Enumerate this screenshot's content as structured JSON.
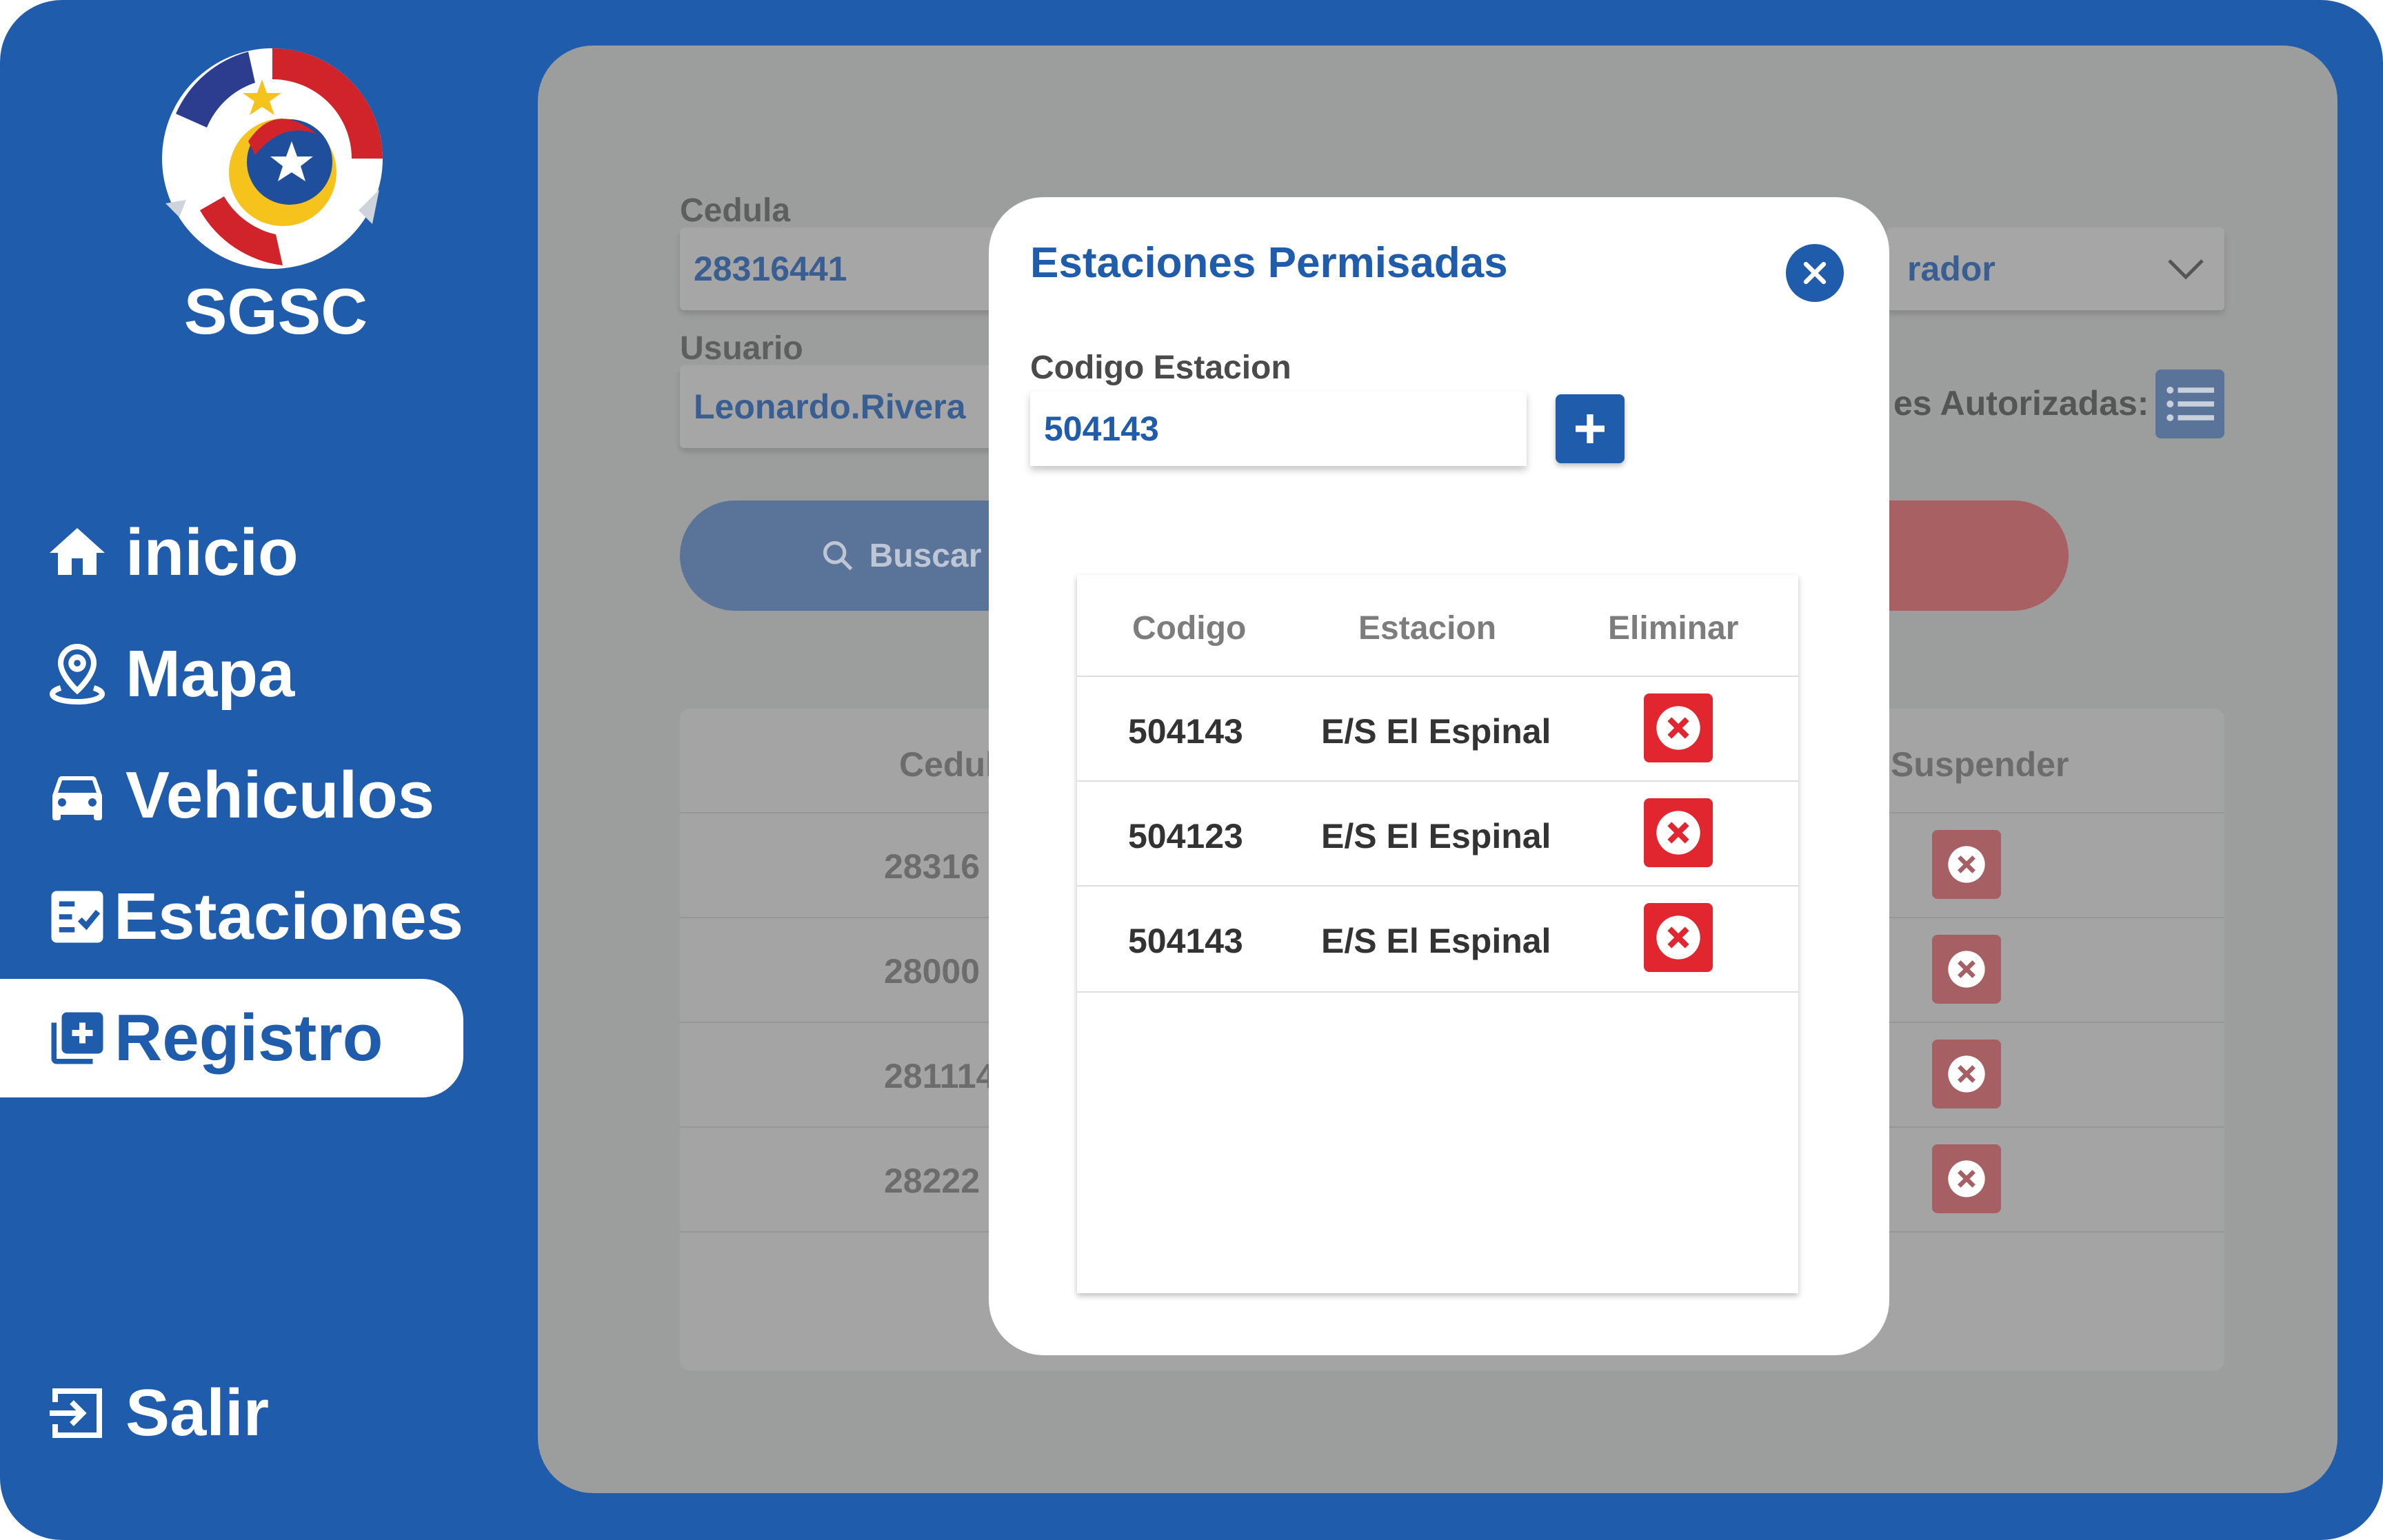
{
  "app": {
    "brand": "SGSC"
  },
  "sidebar": {
    "items": [
      {
        "label": "inicio",
        "icon": "home-icon"
      },
      {
        "label": "Mapa",
        "icon": "map-pin-icon"
      },
      {
        "label": "Vehiculos",
        "icon": "car-icon"
      },
      {
        "label": "Estaciones",
        "icon": "checklist-icon"
      },
      {
        "label": "Registro",
        "icon": "add-box-icon",
        "active": true
      }
    ],
    "logout": {
      "label": "Salir",
      "icon": "logout-icon"
    }
  },
  "form": {
    "cedula_label": "Cedula",
    "cedula_value": "28316441",
    "usuario_label": "Usuario",
    "usuario_value": "Leonardo.Rivera",
    "role_value_partial": "rador",
    "estaciones_label_partial": "es Autorizadas:",
    "search_label": "Buscar"
  },
  "background_table": {
    "headers": {
      "cedula_partial": "Cedul",
      "suspender": "Suspender"
    },
    "rows": [
      {
        "cedula_partial": "28316"
      },
      {
        "cedula_partial": "28000"
      },
      {
        "cedula_partial": "281114"
      },
      {
        "cedula_partial": "28222"
      }
    ]
  },
  "modal": {
    "title": "Estaciones Permisadas",
    "code_label": "Codigo Estacion",
    "code_value": "504143",
    "table": {
      "headers": {
        "codigo": "Codigo",
        "estacion": "Estacion",
        "eliminar": "Eliminar"
      },
      "rows": [
        {
          "codigo": "504143",
          "estacion": "E/S El Espinal"
        },
        {
          "codigo": "504123",
          "estacion": "E/S El Espinal"
        },
        {
          "codigo": "504143",
          "estacion": "E/S El Espinal"
        }
      ]
    }
  },
  "colors": {
    "brand_blue": "#1f5cab",
    "delete_red": "#e1262f",
    "overlay_gray": "#9c9d9d"
  }
}
